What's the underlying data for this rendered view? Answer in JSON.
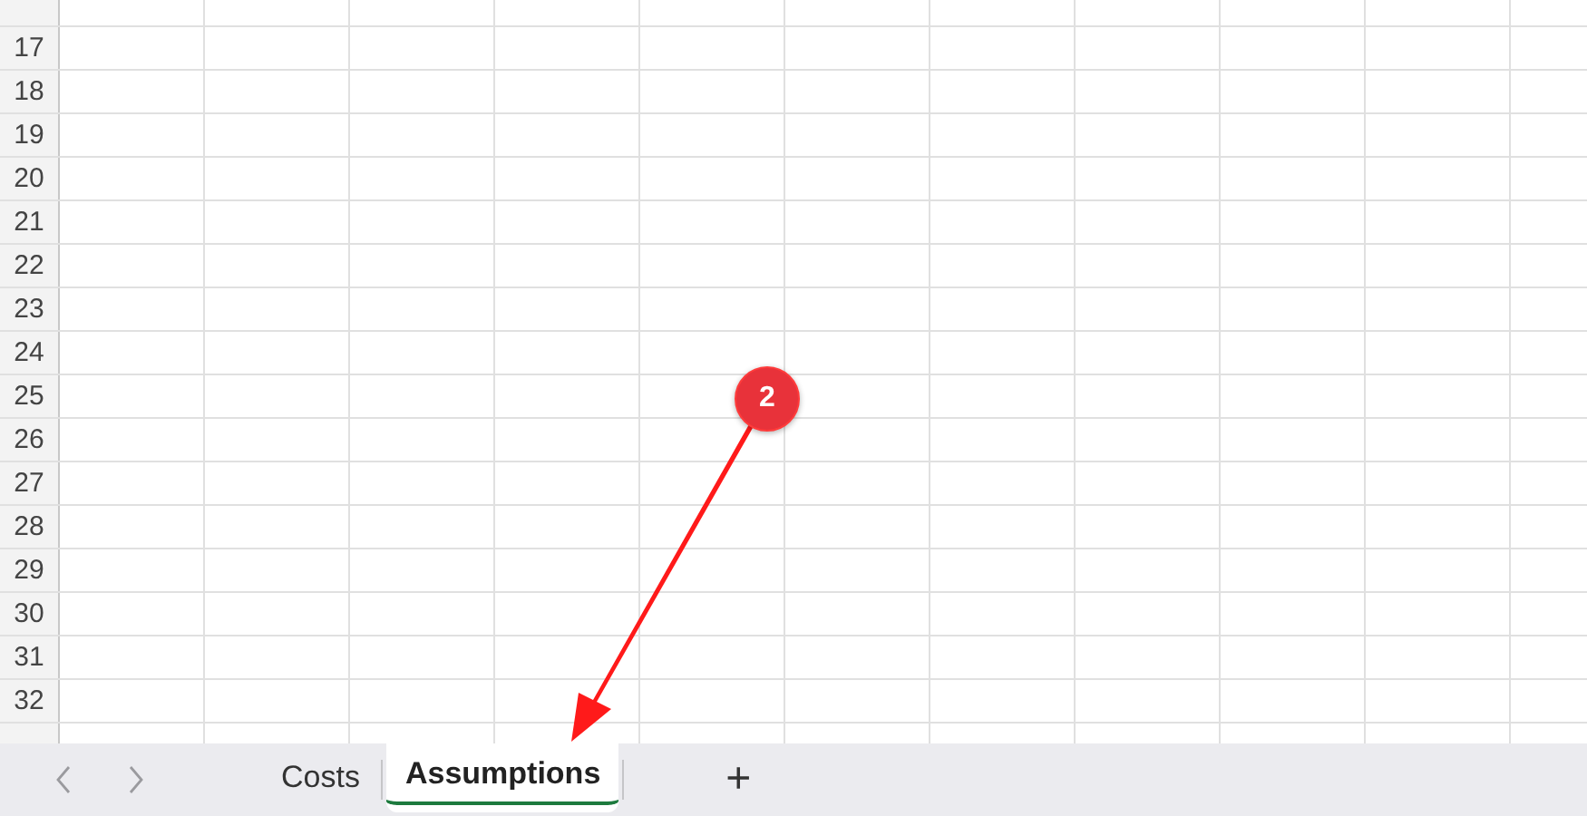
{
  "sheet": {
    "rows": [
      "17",
      "18",
      "19",
      "20",
      "21",
      "22",
      "23",
      "24",
      "25",
      "26",
      "27",
      "28",
      "29",
      "30",
      "31",
      "32"
    ]
  },
  "tabs": [
    {
      "label": "Costs",
      "selected": false
    },
    {
      "label": "Assumptions",
      "selected": true
    }
  ],
  "add_sheet": "+",
  "annotation": {
    "badge": "2"
  }
}
